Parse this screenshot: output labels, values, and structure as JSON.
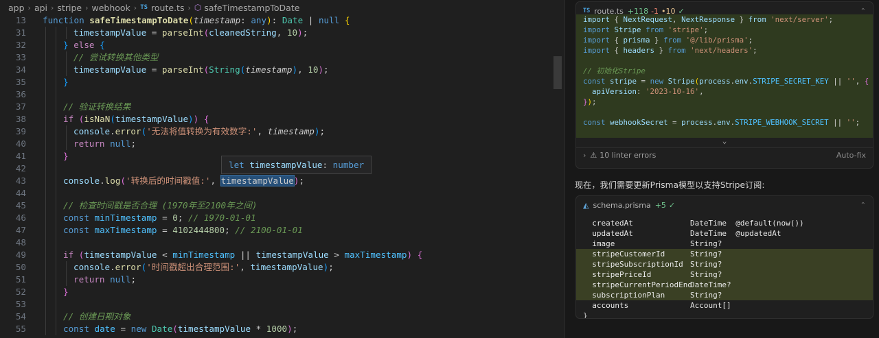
{
  "breadcrumb": {
    "parts": [
      "app",
      "api",
      "stripe",
      "webhook"
    ],
    "ts_tag": "TS",
    "file": "route.ts",
    "symbol": "safeTimestampToDate"
  },
  "editor": {
    "lines": [
      {
        "n": "13",
        "indent": 0,
        "tokens": [
          [
            "kw",
            "function "
          ],
          [
            "fnb",
            "safeTimestampToDate"
          ],
          [
            "br1",
            "("
          ],
          [
            "par",
            "timestamp"
          ],
          [
            "pu",
            ": "
          ],
          [
            "typk",
            "any"
          ],
          [
            "br1",
            ")"
          ],
          [
            "pu",
            ": "
          ],
          [
            "typ",
            "Date"
          ],
          [
            "pu",
            " | "
          ],
          [
            "typk",
            "null"
          ],
          [
            "pu",
            " "
          ],
          [
            "br1",
            "{"
          ]
        ]
      },
      {
        "n": "31",
        "indent": 3,
        "tokens": [
          [
            "var",
            "timestampValue"
          ],
          [
            "pu",
            " = "
          ],
          [
            "fn",
            "parseInt"
          ],
          [
            "br2",
            "("
          ],
          [
            "var",
            "cleanedString"
          ],
          [
            "pu",
            ", "
          ],
          [
            "num",
            "10"
          ],
          [
            "br2",
            ")"
          ],
          [
            "pu",
            ";"
          ]
        ]
      },
      {
        "n": "32",
        "indent": 2,
        "tokens": [
          [
            "br3",
            "}"
          ],
          [
            "pu",
            " "
          ],
          [
            "ctl",
            "else"
          ],
          [
            "pu",
            " "
          ],
          [
            "br3",
            "{"
          ]
        ]
      },
      {
        "n": "33",
        "indent": 3,
        "tokens": [
          [
            "cmt",
            "// 尝试转换其他类型"
          ]
        ]
      },
      {
        "n": "34",
        "indent": 3,
        "tokens": [
          [
            "var",
            "timestampValue"
          ],
          [
            "pu",
            " = "
          ],
          [
            "fn",
            "parseInt"
          ],
          [
            "br2",
            "("
          ],
          [
            "typ",
            "String"
          ],
          [
            "br3",
            "("
          ],
          [
            "par",
            "timestamp"
          ],
          [
            "br3",
            ")"
          ],
          [
            "pu",
            ", "
          ],
          [
            "num",
            "10"
          ],
          [
            "br2",
            ")"
          ],
          [
            "pu",
            ";"
          ]
        ]
      },
      {
        "n": "35",
        "indent": 2,
        "tokens": [
          [
            "br3",
            "}"
          ]
        ]
      },
      {
        "n": "36",
        "indent": 0,
        "tokens": []
      },
      {
        "n": "37",
        "indent": 2,
        "tokens": [
          [
            "cmt",
            "// 验证转换结果"
          ]
        ]
      },
      {
        "n": "38",
        "indent": 2,
        "tokens": [
          [
            "ctl",
            "if"
          ],
          [
            "pu",
            " "
          ],
          [
            "br2",
            "("
          ],
          [
            "fn",
            "isNaN"
          ],
          [
            "br3",
            "("
          ],
          [
            "var",
            "timestampValue"
          ],
          [
            "br3",
            ")"
          ],
          [
            "br2",
            ")"
          ],
          [
            "pu",
            " "
          ],
          [
            "br2",
            "{"
          ]
        ]
      },
      {
        "n": "39",
        "indent": 3,
        "tokens": [
          [
            "var",
            "console"
          ],
          [
            "pu",
            "."
          ],
          [
            "fn",
            "error"
          ],
          [
            "br3",
            "("
          ],
          [
            "str",
            "'无法将值转换为有效数字:'"
          ],
          [
            "pu",
            ", "
          ],
          [
            "par",
            "timestamp"
          ],
          [
            "br3",
            ")"
          ],
          [
            "pu",
            ";"
          ]
        ]
      },
      {
        "n": "40",
        "indent": 3,
        "tokens": [
          [
            "ctl",
            "return"
          ],
          [
            "pu",
            " "
          ],
          [
            "kw",
            "null"
          ],
          [
            "pu",
            ";"
          ]
        ]
      },
      {
        "n": "41",
        "indent": 2,
        "tokens": [
          [
            "br2",
            "}"
          ]
        ]
      },
      {
        "n": "42",
        "indent": 0,
        "tokens": []
      },
      {
        "n": "43",
        "indent": 2,
        "tokens": [
          [
            "var",
            "console"
          ],
          [
            "pu",
            "."
          ],
          [
            "fn",
            "log"
          ],
          [
            "br2",
            "("
          ],
          [
            "str",
            "'转换后的时间戳值:'"
          ],
          [
            "pu",
            ", "
          ],
          [
            "hl",
            "timestampValue"
          ],
          [
            "br2",
            ")"
          ],
          [
            "pu",
            ";"
          ]
        ]
      },
      {
        "n": "44",
        "indent": 0,
        "tokens": []
      },
      {
        "n": "45",
        "indent": 2,
        "tokens": [
          [
            "cmt",
            "// 检查时间戳是否合理 (1970年至2100年之间)"
          ]
        ]
      },
      {
        "n": "46",
        "indent": 2,
        "tokens": [
          [
            "kw",
            "const"
          ],
          [
            "pu",
            " "
          ],
          [
            "cst",
            "minTimestamp"
          ],
          [
            "pu",
            " = "
          ],
          [
            "num",
            "0"
          ],
          [
            "pu",
            "; "
          ],
          [
            "cmt",
            "// 1970-01-01"
          ]
        ]
      },
      {
        "n": "47",
        "indent": 2,
        "tokens": [
          [
            "kw",
            "const"
          ],
          [
            "pu",
            " "
          ],
          [
            "cst",
            "maxTimestamp"
          ],
          [
            "pu",
            " = "
          ],
          [
            "num",
            "4102444800"
          ],
          [
            "pu",
            "; "
          ],
          [
            "cmt",
            "// 2100-01-01"
          ]
        ]
      },
      {
        "n": "48",
        "indent": 0,
        "tokens": []
      },
      {
        "n": "49",
        "indent": 2,
        "tokens": [
          [
            "ctl",
            "if"
          ],
          [
            "pu",
            " "
          ],
          [
            "br2",
            "("
          ],
          [
            "var",
            "timestampValue"
          ],
          [
            "pu",
            " < "
          ],
          [
            "cst",
            "minTimestamp"
          ],
          [
            "pu",
            " || "
          ],
          [
            "var",
            "timestampValue"
          ],
          [
            "pu",
            " > "
          ],
          [
            "cst",
            "maxTimestamp"
          ],
          [
            "br2",
            ")"
          ],
          [
            "pu",
            " "
          ],
          [
            "br2",
            "{"
          ]
        ]
      },
      {
        "n": "50",
        "indent": 3,
        "tokens": [
          [
            "var",
            "console"
          ],
          [
            "pu",
            "."
          ],
          [
            "fn",
            "error"
          ],
          [
            "br3",
            "("
          ],
          [
            "str",
            "'时间戳超出合理范围:'"
          ],
          [
            "pu",
            ", "
          ],
          [
            "var",
            "timestampValue"
          ],
          [
            "br3",
            ")"
          ],
          [
            "pu",
            ";"
          ]
        ]
      },
      {
        "n": "51",
        "indent": 3,
        "tokens": [
          [
            "ctl",
            "return"
          ],
          [
            "pu",
            " "
          ],
          [
            "kw",
            "null"
          ],
          [
            "pu",
            ";"
          ]
        ]
      },
      {
        "n": "52",
        "indent": 2,
        "tokens": [
          [
            "br2",
            "}"
          ]
        ]
      },
      {
        "n": "53",
        "indent": 0,
        "tokens": []
      },
      {
        "n": "54",
        "indent": 2,
        "tokens": [
          [
            "cmt",
            "// 创建日期对象"
          ]
        ]
      },
      {
        "n": "55",
        "indent": 2,
        "tokens": [
          [
            "kw",
            "const"
          ],
          [
            "pu",
            " "
          ],
          [
            "cst",
            "date"
          ],
          [
            "pu",
            " = "
          ],
          [
            "kw",
            "new"
          ],
          [
            "pu",
            " "
          ],
          [
            "typ",
            "Date"
          ],
          [
            "br2",
            "("
          ],
          [
            "var",
            "timestampValue"
          ],
          [
            "pu",
            " * "
          ],
          [
            "num",
            "1000"
          ],
          [
            "br2",
            ")"
          ],
          [
            "pu",
            ";"
          ]
        ]
      }
    ],
    "hover": {
      "kw": "let",
      "name": "timestampValue",
      "type": "number"
    }
  },
  "chat": {
    "route_card": {
      "ts_tag": "TS",
      "file": "route.ts",
      "added": "+118",
      "removed": "-1",
      "modified": "•10",
      "check": "✓",
      "snippet": [
        [
          [
            "var",
            "import"
          ],
          [
            "pu",
            " { "
          ],
          [
            "var",
            "NextRequest"
          ],
          [
            "pu",
            ", "
          ],
          [
            "var",
            "NextResponse"
          ],
          [
            "pu",
            " } "
          ],
          [
            "var",
            "from"
          ],
          [
            "pu",
            " "
          ],
          [
            "str",
            "'next/server'"
          ],
          [
            "pu",
            ";"
          ]
        ],
        [
          [
            "kw",
            "import"
          ],
          [
            "pu",
            " "
          ],
          [
            "var",
            "Stripe"
          ],
          [
            "pu",
            " "
          ],
          [
            "kw",
            "from"
          ],
          [
            "pu",
            " "
          ],
          [
            "str",
            "'stripe'"
          ],
          [
            "pu",
            ";"
          ]
        ],
        [
          [
            "kw",
            "import"
          ],
          [
            "pu",
            " { "
          ],
          [
            "var",
            "prisma"
          ],
          [
            "pu",
            " } "
          ],
          [
            "kw",
            "from"
          ],
          [
            "pu",
            " "
          ],
          [
            "str",
            "'@/lib/prisma'"
          ],
          [
            "pu",
            ";"
          ]
        ],
        [
          [
            "kw",
            "import"
          ],
          [
            "pu",
            " { "
          ],
          [
            "var",
            "headers"
          ],
          [
            "pu",
            " } "
          ],
          [
            "kw",
            "from"
          ],
          [
            "pu",
            " "
          ],
          [
            "str",
            "'next/headers'"
          ],
          [
            "pu",
            ";"
          ]
        ],
        [],
        [
          [
            "cmt",
            "// 初始化Stripe"
          ]
        ],
        [
          [
            "kw",
            "const"
          ],
          [
            "pu",
            " "
          ],
          [
            "var",
            "stripe"
          ],
          [
            "pu",
            " = "
          ],
          [
            "kw",
            "new"
          ],
          [
            "pu",
            " "
          ],
          [
            "var",
            "Stripe"
          ],
          [
            "br1",
            "("
          ],
          [
            "var",
            "process"
          ],
          [
            "pu",
            "."
          ],
          [
            "var",
            "env"
          ],
          [
            "pu",
            "."
          ],
          [
            "cst",
            "STRIPE_SECRET_KEY"
          ],
          [
            "pu",
            " || "
          ],
          [
            "str",
            "''"
          ],
          [
            "pu",
            ", "
          ],
          [
            "br2",
            "{"
          ]
        ],
        [
          [
            "pu",
            "  "
          ],
          [
            "var",
            "apiVersion"
          ],
          [
            "pu",
            ": "
          ],
          [
            "str",
            "'2023-10-16'"
          ],
          [
            "pu",
            ","
          ]
        ],
        [
          [
            "br2",
            "}"
          ],
          [
            "br1",
            ")"
          ],
          [
            "pu",
            ";"
          ]
        ],
        [],
        [
          [
            "kw",
            "const"
          ],
          [
            "pu",
            " "
          ],
          [
            "var",
            "webhookSecret"
          ],
          [
            "pu",
            " = "
          ],
          [
            "var",
            "process"
          ],
          [
            "pu",
            "."
          ],
          [
            "var",
            "env"
          ],
          [
            "pu",
            "."
          ],
          [
            "cst",
            "STRIPE_WEBHOOK_SECRET"
          ],
          [
            "pu",
            " || "
          ],
          [
            "str",
            "''"
          ],
          [
            "pu",
            ";"
          ]
        ],
        [],
        [
          [
            "kw",
            "export"
          ],
          [
            "pu",
            " "
          ],
          [
            "kw",
            "async"
          ],
          [
            "pu",
            " "
          ],
          [
            "kw",
            "function"
          ],
          [
            "pu",
            " "
          ],
          [
            "fn",
            "POST"
          ],
          [
            "br1",
            "("
          ],
          [
            "par",
            "request"
          ],
          [
            "pu",
            ": "
          ],
          [
            "typ",
            "NextRequest"
          ],
          [
            "br1",
            ")"
          ],
          [
            "pu",
            " "
          ],
          [
            "br1",
            "{"
          ]
        ],
        [
          [
            "pu",
            "  "
          ],
          [
            "ctl",
            "try"
          ],
          [
            "pu",
            " "
          ],
          [
            "br2",
            "{"
          ]
        ]
      ],
      "expand_icon": "⌄",
      "lint_label": "10 linter errors",
      "autofix_label": "Auto-fix"
    },
    "message": "现在，我们需要更新Prisma模型以支持Stripe订阅:",
    "prisma_card": {
      "file": "schema.prisma",
      "added": "+5",
      "check": "✓",
      "rows": [
        {
          "field": "createdAt",
          "type": "DateTime  @default(now())",
          "on": false
        },
        {
          "field": "updatedAt",
          "type": "DateTime  @updatedAt",
          "on": false
        },
        {
          "field": "image",
          "type": "String?",
          "on": false
        },
        {
          "field": "stripeCustomerId",
          "type": "String?",
          "on": true
        },
        {
          "field": "stripeSubscriptionId",
          "type": "String?",
          "on": true
        },
        {
          "field": "stripePriceId",
          "type": "String?",
          "on": true
        },
        {
          "field": "stripeCurrentPeriodEnd",
          "type": "DateTime?",
          "on": true
        },
        {
          "field": "subscriptionPlan",
          "type": "String?",
          "on": true
        },
        {
          "field": "accounts",
          "type": "Account[]",
          "on": false
        }
      ],
      "closing": "}"
    }
  }
}
